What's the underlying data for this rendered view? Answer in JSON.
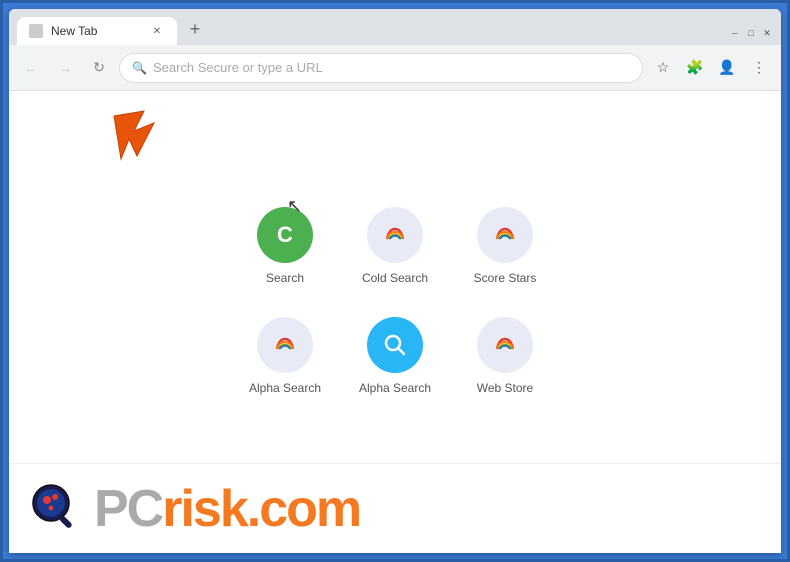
{
  "browser": {
    "tab_title": "New Tab",
    "address_placeholder": "Search Secure or type a URL",
    "new_tab_btn": "+",
    "window_controls": {
      "minimize": "─",
      "maximize": "□",
      "close": "✕"
    }
  },
  "shortcuts": [
    {
      "id": 1,
      "label": "Search",
      "icon_type": "letter",
      "letter": "C",
      "color": "green"
    },
    {
      "id": 2,
      "label": "Cold Search",
      "icon_type": "rainbow"
    },
    {
      "id": 3,
      "label": "Score Stars",
      "icon_type": "rainbow"
    },
    {
      "id": 4,
      "label": "Alpha Search",
      "icon_type": "rainbow"
    },
    {
      "id": 5,
      "label": "Alpha Search",
      "icon_type": "search_blue"
    },
    {
      "id": 6,
      "label": "Web Store",
      "icon_type": "rainbow"
    }
  ],
  "watermark": {
    "brand_gray": "PC",
    "brand_orange": "risk.com"
  },
  "colors": {
    "accent": "#f47920",
    "arrow": "#e8550a",
    "green": "#4caf50",
    "blue": "#1a73e8"
  }
}
